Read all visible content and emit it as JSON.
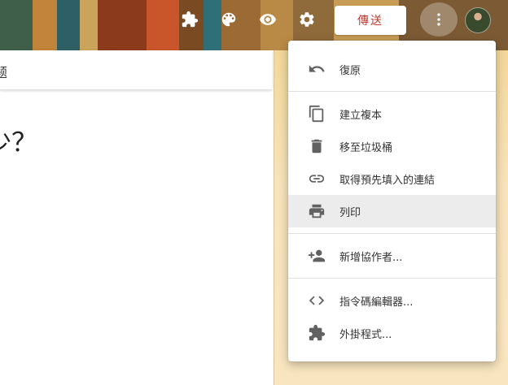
{
  "toolbar": {
    "addons_icon": "puzzle-icon",
    "palette_icon": "palette-icon",
    "preview_icon": "eye-icon",
    "settings_icon": "gear-icon",
    "send_label": "傳送",
    "more_icon": "more-vert-icon"
  },
  "form": {
    "header_label": "题",
    "question_fragment": "少？"
  },
  "menu": {
    "items": [
      {
        "label": "復原",
        "icon": "undo-icon"
      },
      {
        "label": "建立複本",
        "icon": "copy-icon"
      },
      {
        "label": "移至垃圾桶",
        "icon": "trash-icon"
      },
      {
        "label": "取得預先填入的連結",
        "icon": "link-icon"
      },
      {
        "label": "列印",
        "icon": "print-icon"
      },
      {
        "label": "新增協作者...",
        "icon": "add-people-icon"
      },
      {
        "label": "指令碼編輯器...",
        "icon": "code-icon"
      },
      {
        "label": "外掛程式...",
        "icon": "puzzle-icon"
      }
    ]
  },
  "colors": {
    "accent_send_text": "#c0392b",
    "menu_highlight": "#ececec",
    "icon_gray": "#616161"
  }
}
